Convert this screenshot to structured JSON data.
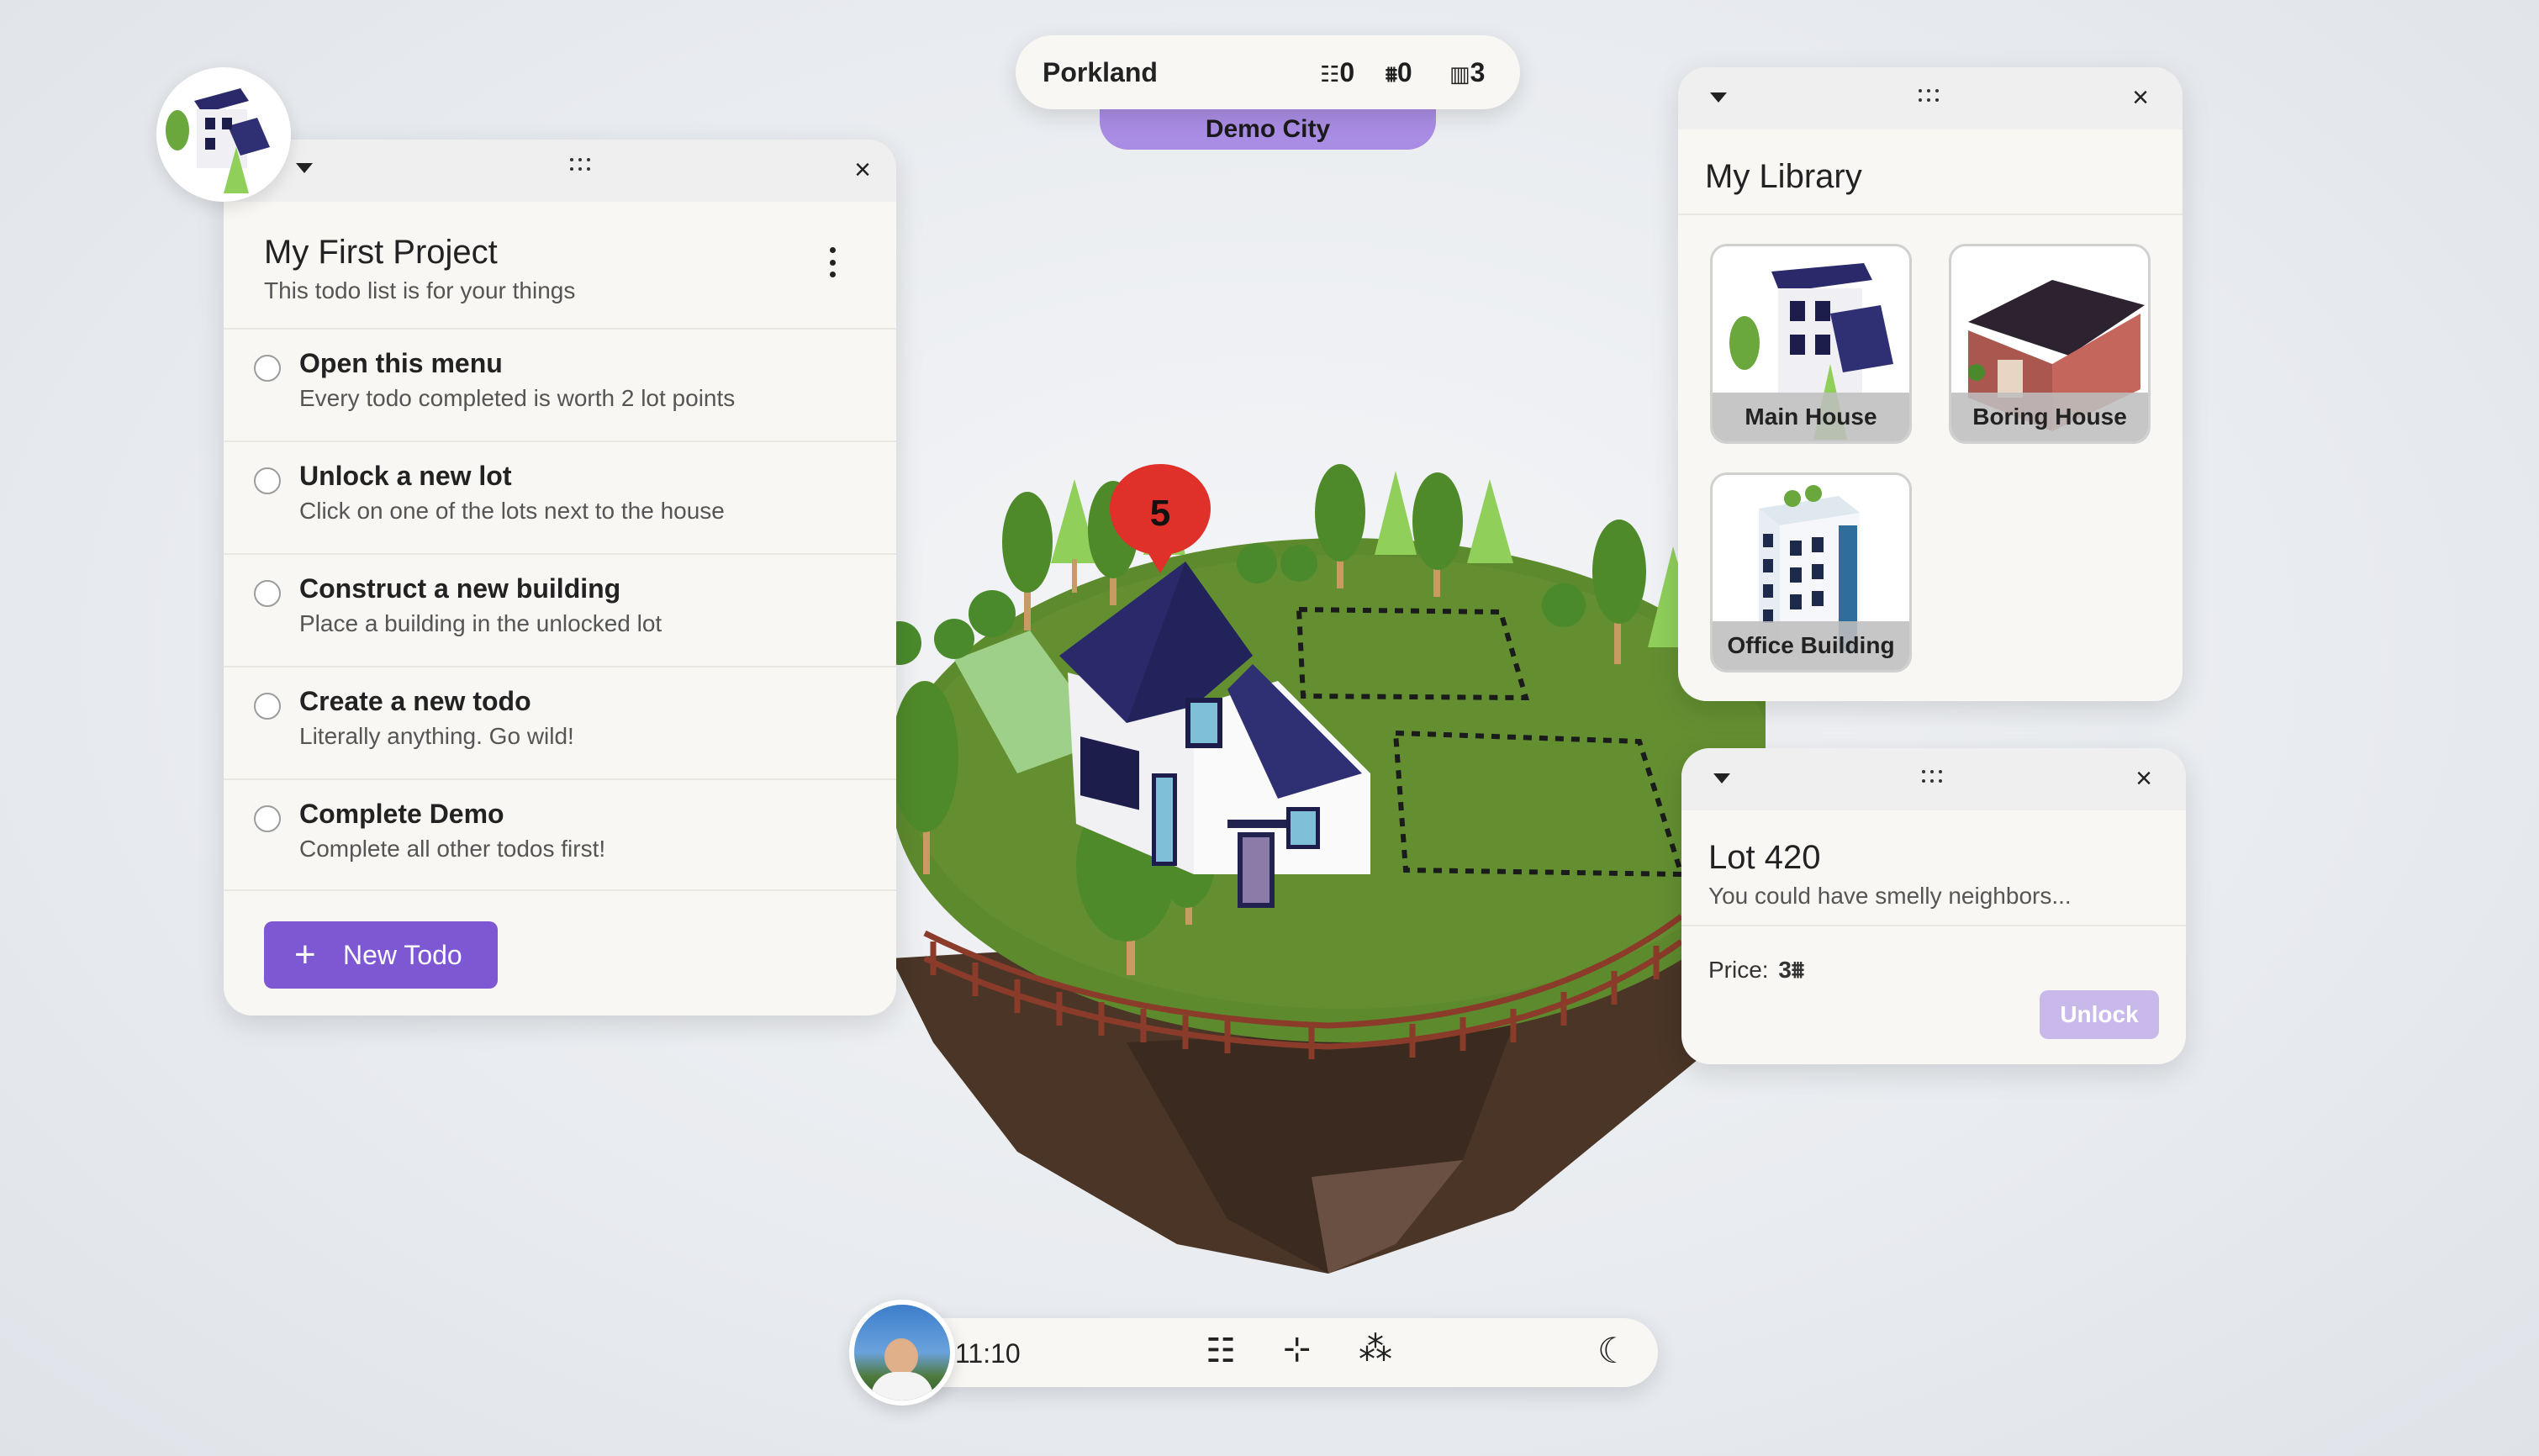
{
  "city_bar": {
    "name": "Porkland",
    "todo_count": "0",
    "points_count": "0",
    "building_count": "3",
    "city_label": "Demo City"
  },
  "project": {
    "title": "My First Project",
    "subtitle": "This todo list is for your things",
    "todos": [
      {
        "title": "Open this menu",
        "desc": "Every todo completed is worth 2 lot points"
      },
      {
        "title": "Unlock a new lot",
        "desc": "Click on one of the lots next to the house"
      },
      {
        "title": "Construct a new building",
        "desc": "Place a building in the unlocked lot"
      },
      {
        "title": "Create a new todo",
        "desc": "Literally anything. Go wild!"
      },
      {
        "title": "Complete Demo",
        "desc": "Complete all other todos first!"
      }
    ],
    "new_todo_label": "New Todo"
  },
  "library": {
    "title": "My Library",
    "items": [
      {
        "label": "Main House"
      },
      {
        "label": "Boring House"
      },
      {
        "label": "Office Building"
      }
    ]
  },
  "lot": {
    "title": "Lot 420",
    "subtitle": "You could have smelly neighbors...",
    "price_label": "Price:",
    "price_value": "3",
    "unlock_label": "Unlock"
  },
  "marker": {
    "count": "5"
  },
  "dock": {
    "time": "11:10"
  },
  "colors": {
    "accent": "#7e58d3",
    "unlock_disabled": "#c9b8ea",
    "marker": "#e0302a",
    "grass": "#5e8a2e"
  }
}
